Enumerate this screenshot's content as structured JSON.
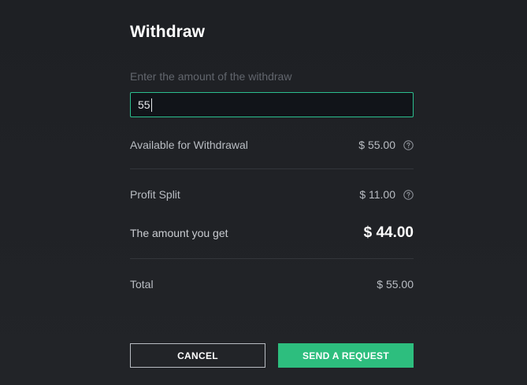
{
  "dialog": {
    "title": "Withdraw",
    "field_label": "Enter the amount of the withdraw",
    "input_value": "55",
    "rows": {
      "available": {
        "label": "Available for Withdrawal",
        "value": "$ 55.00",
        "icon": "help-circle-icon"
      },
      "profit_split": {
        "label": "Profit Split",
        "value": "$ 11.00",
        "icon": "help-circle-icon"
      },
      "amount_get": {
        "label": "The amount you get",
        "value": "$ 44.00"
      },
      "total": {
        "label": "Total",
        "value": "$ 55.00"
      }
    },
    "buttons": {
      "cancel": "CANCEL",
      "send": "SEND A REQUEST"
    }
  },
  "colors": {
    "accent": "#2dbe7e",
    "input_border": "#2bbf8e",
    "background": "#212327"
  }
}
